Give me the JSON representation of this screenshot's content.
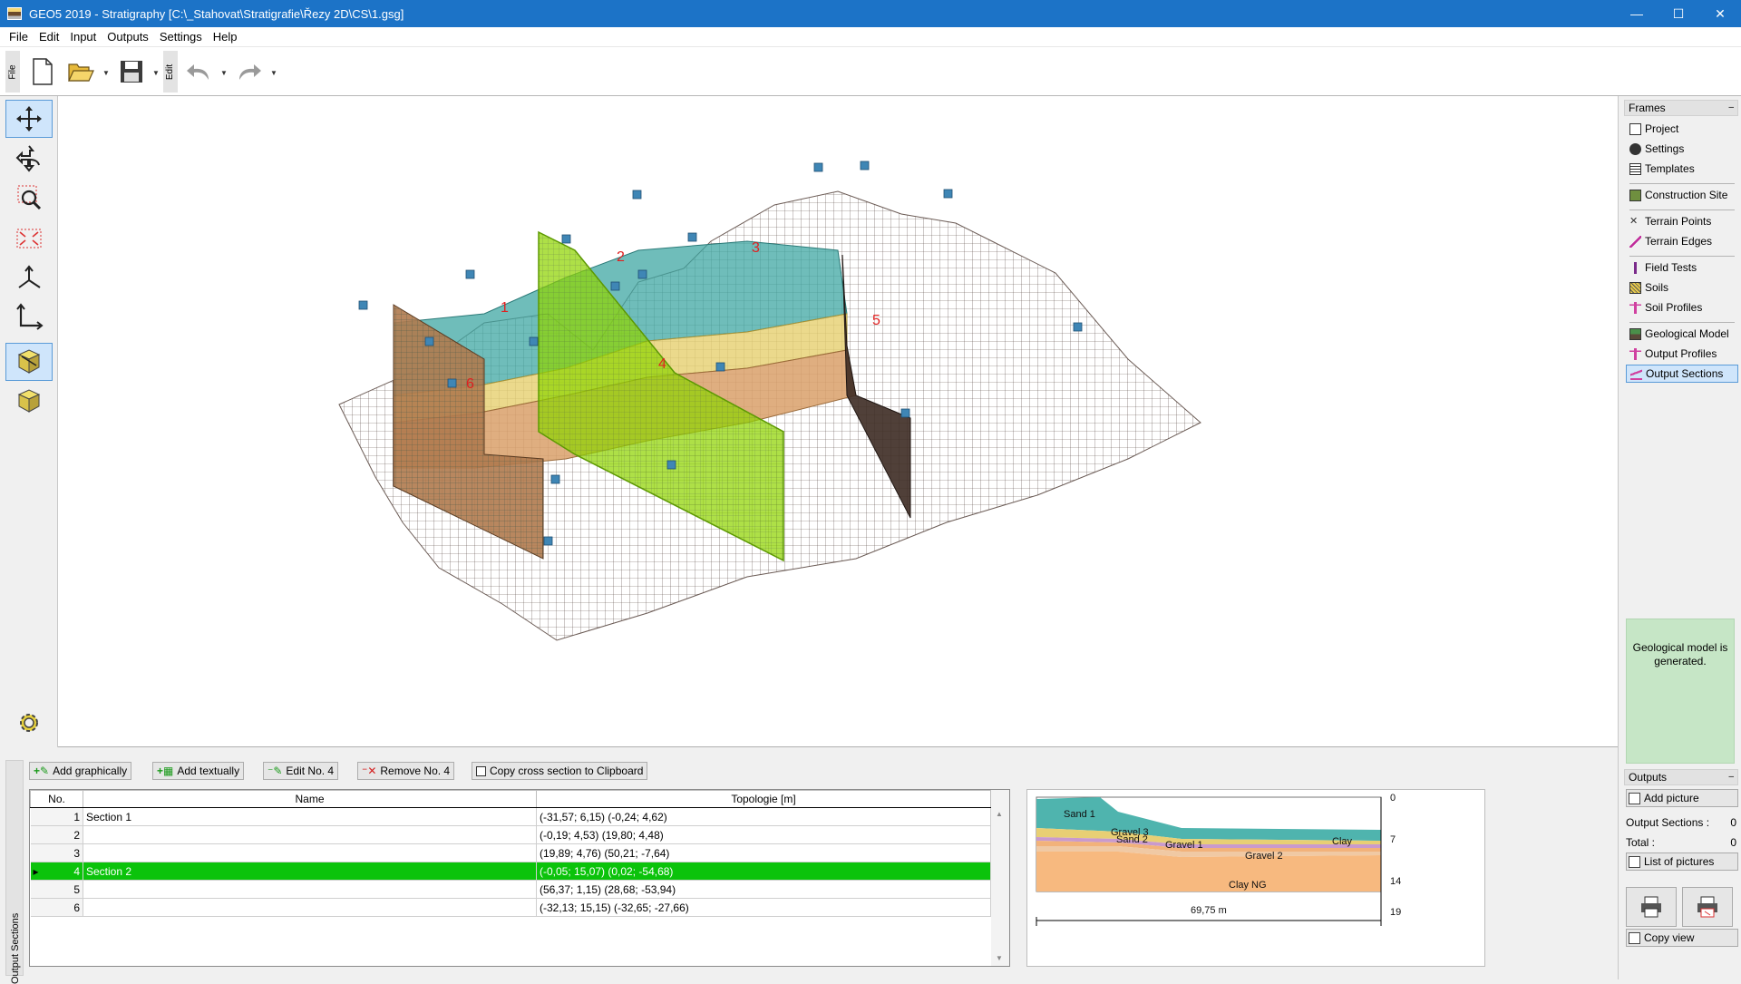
{
  "window": {
    "title": "GEO5 2019 - Stratigraphy [C:\\_Stahovat\\Stratigrafie\\Řezy 2D\\CS\\1.gsg]",
    "controls": {
      "minimize": "—",
      "maximize": "☐",
      "close": "✕"
    }
  },
  "menu": [
    "File",
    "Edit",
    "Input",
    "Outputs",
    "Settings",
    "Help"
  ],
  "toolbar": {
    "file_label": "File",
    "edit_label": "Edit"
  },
  "left_tools": [
    "move-icon",
    "rotate-icon",
    "zoom-window-icon",
    "zoom-extents-icon",
    "axes-3d-icon",
    "axes-2d-icon",
    "view-3d-section-icon",
    "view-3d-model-icon",
    "settings-gear-icon"
  ],
  "viewport": {
    "section_labels": [
      "1",
      "2",
      "3",
      "4",
      "5",
      "6"
    ],
    "colors": {
      "mesh": "#5a4a45",
      "section_highlight": "#8fd400",
      "sand": "#3fa7a3",
      "clay": "#d9a06a",
      "gravel": "#e6cf6f"
    }
  },
  "frames": {
    "header": "Frames",
    "collapse": "–",
    "items": [
      {
        "label": "Project",
        "icon": "project-icon"
      },
      {
        "label": "Settings",
        "icon": "settings-icon"
      },
      {
        "label": "Templates",
        "icon": "templates-icon"
      },
      {
        "label": "Construction Site",
        "icon": "construction-site-icon"
      },
      {
        "label": "Terrain Points",
        "icon": "terrain-points-icon"
      },
      {
        "label": "Terrain Edges",
        "icon": "terrain-edges-icon"
      },
      {
        "label": "Field Tests",
        "icon": "field-tests-icon"
      },
      {
        "label": "Soils",
        "icon": "soils-icon"
      },
      {
        "label": "Soil Profiles",
        "icon": "soil-profiles-icon"
      },
      {
        "label": "Geological Model",
        "icon": "geological-model-icon"
      },
      {
        "label": "Output Profiles",
        "icon": "output-profiles-icon"
      },
      {
        "label": "Output Sections",
        "icon": "output-sections-icon"
      }
    ],
    "active": "Output Sections",
    "status": "Geological model is generated."
  },
  "outputs": {
    "header": "Outputs",
    "collapse": "–",
    "add_picture": "Add picture",
    "output_sections_label": "Output Sections :",
    "output_sections_value": "0",
    "total_label": "Total :",
    "total_value": "0",
    "list_pictures": "List of pictures",
    "copy_view": "Copy view"
  },
  "bottom": {
    "tab_label": "Output Sections",
    "buttons": {
      "add_graphically": "Add graphically",
      "add_textually": "Add textually",
      "edit": "Edit No. 4",
      "remove": "Remove No. 4",
      "copy": "Copy cross section to Clipboard"
    },
    "table": {
      "headers": [
        "No.",
        "Name",
        "Topologie [m]"
      ],
      "rows": [
        {
          "no": "1",
          "name": "Section 1",
          "topology": "(-31,57; 6,15) (-0,24; 4,62)"
        },
        {
          "no": "2",
          "name": "",
          "topology": "(-0,19; 4,53) (19,80; 4,48)"
        },
        {
          "no": "3",
          "name": "",
          "topology": "(19,89; 4,76) (50,21; -7,64)"
        },
        {
          "no": "4",
          "name": "Section 2",
          "topology": "(-0,05; 15,07) (0,02; -54,68)",
          "selected": true,
          "marker": "▸"
        },
        {
          "no": "5",
          "name": "",
          "topology": "(56,37; 1,15) (28,68; -53,94)"
        },
        {
          "no": "6",
          "name": "",
          "topology": "(-32,13; 15,15) (-32,65; -27,66)"
        }
      ]
    }
  },
  "preview": {
    "layer_labels": [
      "Sand 1",
      "Gravel 3",
      "Sand 2",
      "Gravel 1",
      "Clay",
      "Gravel 2",
      "Clay NG"
    ],
    "depth_ticks": [
      "0",
      "7",
      "14",
      "19"
    ],
    "width_label": "69,75 m"
  }
}
